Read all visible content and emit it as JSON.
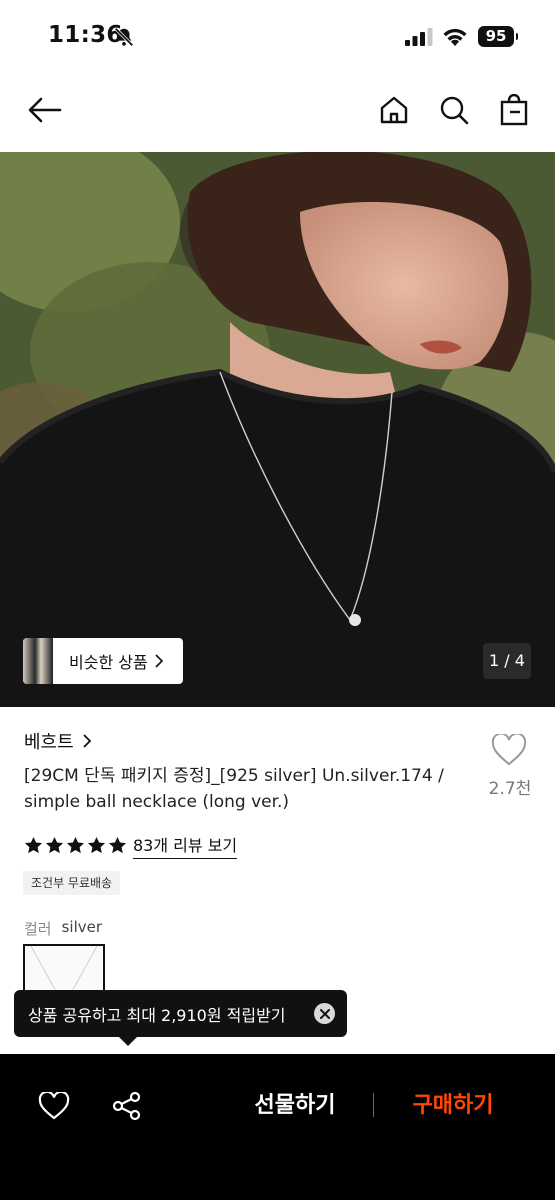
{
  "status_bar": {
    "time": "11:36",
    "battery": "95",
    "icons": [
      "bell-slash-icon",
      "signal-icon",
      "wifi-icon",
      "battery-icon"
    ]
  },
  "nav": {
    "icons": [
      "arrow-left-icon",
      "home-icon",
      "search-icon",
      "shopping-bag-icon"
    ]
  },
  "gallery": {
    "similar_label": "비슷한 상품",
    "counter": "1 / 4"
  },
  "product": {
    "brand": "베흐트",
    "title": "[29CM 단독 패키지 증정]_[925 silver] Un.silver.174 / simple ball necklace (long ver.)",
    "like_count": "2.7천",
    "rating_stars": 5,
    "review_link": "83개 리뷰 보기",
    "shipping_badge": "조건부 무료배송",
    "option_label": "컬러",
    "option_value": "silver"
  },
  "tooltip": {
    "text": "상품 공유하고 최대 2,910원 적립받기"
  },
  "bottom_bar": {
    "gift_label": "선물하기",
    "buy_label": "구매하기"
  },
  "colors": {
    "accent": "#ff4800",
    "bottom_bg": "#000000",
    "tooltip_bg": "#111111"
  }
}
